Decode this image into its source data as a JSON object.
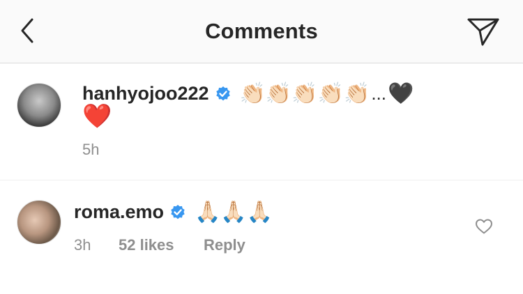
{
  "header": {
    "title": "Comments",
    "back_icon": "chevron-left-icon",
    "send_icon": "paper-plane-icon"
  },
  "caption": {
    "username": "hanhyojoo222",
    "verified": true,
    "emojis": "👏🏻👏🏻👏🏻👏🏻👏🏻",
    "ellipsis": "...",
    "heart_black": "🖤",
    "heart_red": "❤️",
    "time": "5h"
  },
  "comments": [
    {
      "username": "roma.emo",
      "verified": true,
      "text": "🙏🏻🙏🏻🙏🏻",
      "time": "3h",
      "likes": "52 likes",
      "reply_label": "Reply",
      "like_icon": "heart-outline-icon"
    }
  ],
  "colors": {
    "header_bg": "#fafafa",
    "text": "#262626",
    "meta": "#8e8e8e",
    "verified": "#3897f0",
    "divider": "#dbdbdb"
  }
}
